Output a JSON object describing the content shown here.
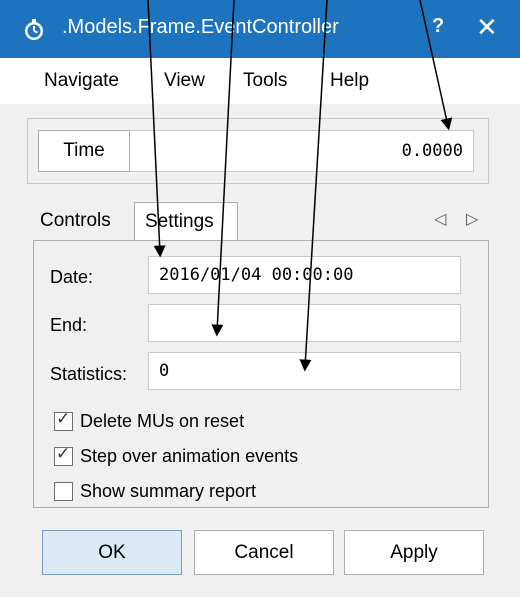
{
  "window": {
    "title": ".Models.Frame.EventController",
    "help_label": "?",
    "close_label": "✕",
    "icon": "stopwatch-icon"
  },
  "menu": {
    "items": [
      {
        "label": "Navigate"
      },
      {
        "label": "View"
      },
      {
        "label": "Tools"
      },
      {
        "label": "Help"
      }
    ]
  },
  "time": {
    "button_label": "Time",
    "value": "0.0000"
  },
  "tabs": {
    "items": [
      {
        "label": "Controls",
        "active": false
      },
      {
        "label": "Settings",
        "active": true
      }
    ],
    "prev_icon": "◁",
    "next_icon": "▷"
  },
  "settings": {
    "date_label": "Date:",
    "date_value": "2016/01/04 00:00:00",
    "end_label": "End:",
    "end_value": "",
    "statistics_label": "Statistics:",
    "statistics_value": "0",
    "checkboxes": [
      {
        "label": "Delete MUs on reset",
        "checked": true
      },
      {
        "label": "Step over animation events",
        "checked": true
      },
      {
        "label": "Show summary report",
        "checked": false
      }
    ]
  },
  "buttons": {
    "ok": "OK",
    "cancel": "Cancel",
    "apply": "Apply"
  },
  "colors": {
    "titlebar": "#1e73be",
    "annotation_arrows": "#000000"
  }
}
